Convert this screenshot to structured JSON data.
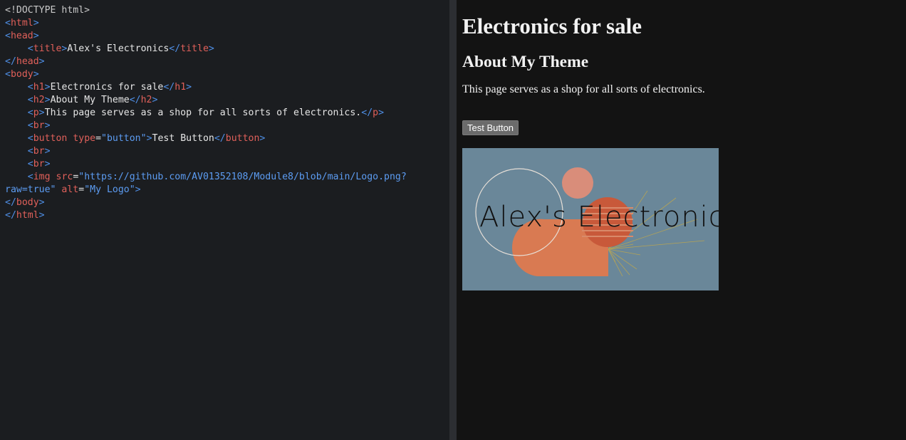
{
  "editor": {
    "lines": [
      [
        {
          "t": "doctype",
          "v": "<!DOCTYPE html>"
        }
      ],
      [
        {
          "t": "bracket",
          "v": "<"
        },
        {
          "t": "tag",
          "v": "html"
        },
        {
          "t": "bracket",
          "v": ">"
        }
      ],
      [
        {
          "t": "bracket",
          "v": "<"
        },
        {
          "t": "tag",
          "v": "head"
        },
        {
          "t": "bracket",
          "v": ">"
        }
      ],
      [
        {
          "t": "text",
          "v": "    "
        },
        {
          "t": "bracket",
          "v": "<"
        },
        {
          "t": "tag",
          "v": "title"
        },
        {
          "t": "bracket",
          "v": ">"
        },
        {
          "t": "text",
          "v": "Alex's Electronics"
        },
        {
          "t": "bracket",
          "v": "</"
        },
        {
          "t": "tag",
          "v": "title"
        },
        {
          "t": "bracket",
          "v": ">"
        }
      ],
      [
        {
          "t": "bracket",
          "v": "</"
        },
        {
          "t": "tag",
          "v": "head"
        },
        {
          "t": "bracket",
          "v": ">"
        }
      ],
      [
        {
          "t": "bracket",
          "v": "<"
        },
        {
          "t": "tag",
          "v": "body"
        },
        {
          "t": "bracket",
          "v": ">"
        }
      ],
      [
        {
          "t": "text",
          "v": "    "
        },
        {
          "t": "bracket",
          "v": "<"
        },
        {
          "t": "tag",
          "v": "h1"
        },
        {
          "t": "bracket",
          "v": ">"
        },
        {
          "t": "text",
          "v": "Electronics for sale"
        },
        {
          "t": "bracket",
          "v": "</"
        },
        {
          "t": "tag",
          "v": "h1"
        },
        {
          "t": "bracket",
          "v": ">"
        }
      ],
      [
        {
          "t": "text",
          "v": "    "
        },
        {
          "t": "bracket",
          "v": "<"
        },
        {
          "t": "tag",
          "v": "h2"
        },
        {
          "t": "bracket",
          "v": ">"
        },
        {
          "t": "text",
          "v": "About My Theme"
        },
        {
          "t": "bracket",
          "v": "</"
        },
        {
          "t": "tag",
          "v": "h2"
        },
        {
          "t": "bracket",
          "v": ">"
        }
      ],
      [
        {
          "t": "text",
          "v": "    "
        },
        {
          "t": "bracket",
          "v": "<"
        },
        {
          "t": "tag",
          "v": "p"
        },
        {
          "t": "bracket",
          "v": ">"
        },
        {
          "t": "text",
          "v": "This page serves as a shop for all sorts of electronics."
        },
        {
          "t": "bracket",
          "v": "</"
        },
        {
          "t": "tag",
          "v": "p"
        },
        {
          "t": "bracket",
          "v": ">"
        }
      ],
      [
        {
          "t": "text",
          "v": "    "
        },
        {
          "t": "bracket",
          "v": "<"
        },
        {
          "t": "tag",
          "v": "br"
        },
        {
          "t": "bracket",
          "v": ">"
        }
      ],
      [
        {
          "t": "text",
          "v": "    "
        },
        {
          "t": "bracket",
          "v": "<"
        },
        {
          "t": "tag",
          "v": "button"
        },
        {
          "t": "text",
          "v": " "
        },
        {
          "t": "attr",
          "v": "type"
        },
        {
          "t": "eq",
          "v": "="
        },
        {
          "t": "str",
          "v": "\"button\""
        },
        {
          "t": "bracket",
          "v": ">"
        },
        {
          "t": "text",
          "v": "Test Button"
        },
        {
          "t": "bracket",
          "v": "</"
        },
        {
          "t": "tag",
          "v": "button"
        },
        {
          "t": "bracket",
          "v": ">"
        }
      ],
      [
        {
          "t": "text",
          "v": "    "
        },
        {
          "t": "bracket",
          "v": "<"
        },
        {
          "t": "tag",
          "v": "br"
        },
        {
          "t": "bracket",
          "v": ">"
        }
      ],
      [
        {
          "t": "text",
          "v": "    "
        },
        {
          "t": "bracket",
          "v": "<"
        },
        {
          "t": "tag",
          "v": "br"
        },
        {
          "t": "bracket",
          "v": ">"
        }
      ],
      [
        {
          "t": "text",
          "v": "    "
        },
        {
          "t": "bracket",
          "v": "<"
        },
        {
          "t": "tag",
          "v": "img"
        },
        {
          "t": "text",
          "v": " "
        },
        {
          "t": "attr",
          "v": "src"
        },
        {
          "t": "eq",
          "v": "="
        },
        {
          "t": "str",
          "v": "\"https://github.com/AV01352108/Module8/blob/main/Logo.png?"
        }
      ],
      [
        {
          "t": "str",
          "v": "raw=true\""
        },
        {
          "t": "text",
          "v": " "
        },
        {
          "t": "attr",
          "v": "alt"
        },
        {
          "t": "eq",
          "v": "="
        },
        {
          "t": "str",
          "v": "\"My Logo\""
        },
        {
          "t": "bracket",
          "v": ">"
        }
      ],
      [
        {
          "t": "bracket",
          "v": "</"
        },
        {
          "t": "tag",
          "v": "body"
        },
        {
          "t": "bracket",
          "v": ">"
        }
      ],
      [
        {
          "t": "bracket",
          "v": "</"
        },
        {
          "t": "tag",
          "v": "html"
        },
        {
          "t": "bracket",
          "v": ">"
        }
      ]
    ]
  },
  "preview": {
    "h1": "Electronics for sale",
    "h2": "About My Theme",
    "paragraph": "This page serves as a shop for all sorts of electronics.",
    "button_label": "Test Button",
    "logo": {
      "text": "Alex's Electronics",
      "background": "#6a8799",
      "accent": "#d97a52"
    }
  }
}
